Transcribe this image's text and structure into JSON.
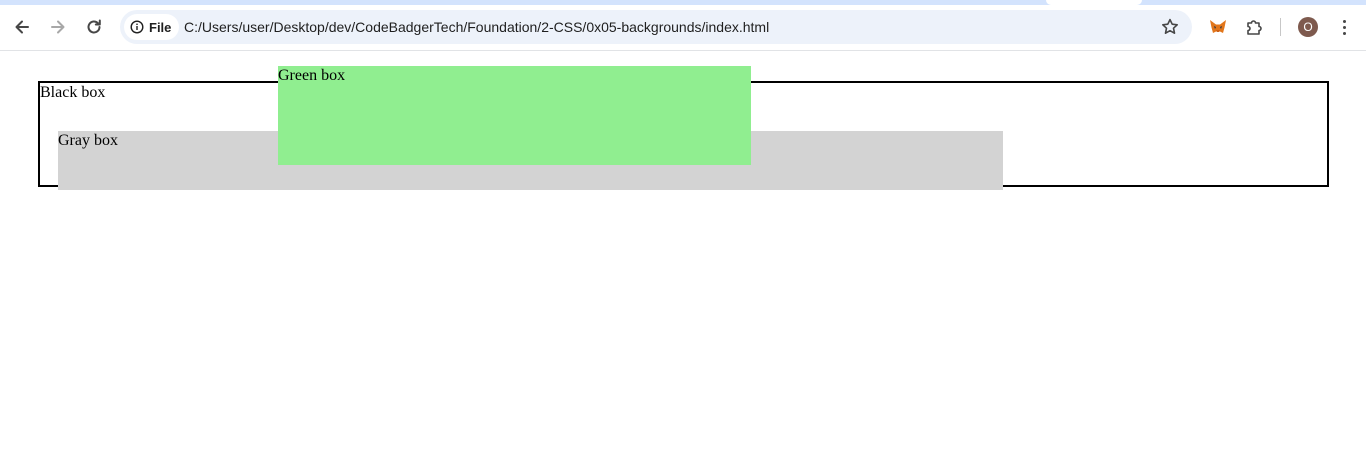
{
  "browser": {
    "site_info_label": "File",
    "url": "C:/Users/user/Desktop/dev/CodeBadgerTech/Foundation/2-CSS/0x05-backgrounds/index.html",
    "profile_initial": "O",
    "icons": {
      "back": "arrow-left-icon",
      "forward": "arrow-right-icon",
      "reload": "reload-icon",
      "info": "info-icon",
      "bookmark": "star-icon",
      "extension_fox": "metamask-fox-icon",
      "extensions": "puzzle-piece-icon",
      "menu": "three-dots-vertical-icon"
    }
  },
  "page": {
    "black_box": {
      "label": "Black box",
      "border_color": "#000000"
    },
    "gray_box": {
      "label": "Gray box",
      "background": "#d3d3d3"
    },
    "green_box": {
      "label": "Green box",
      "background": "#90ee90"
    }
  }
}
